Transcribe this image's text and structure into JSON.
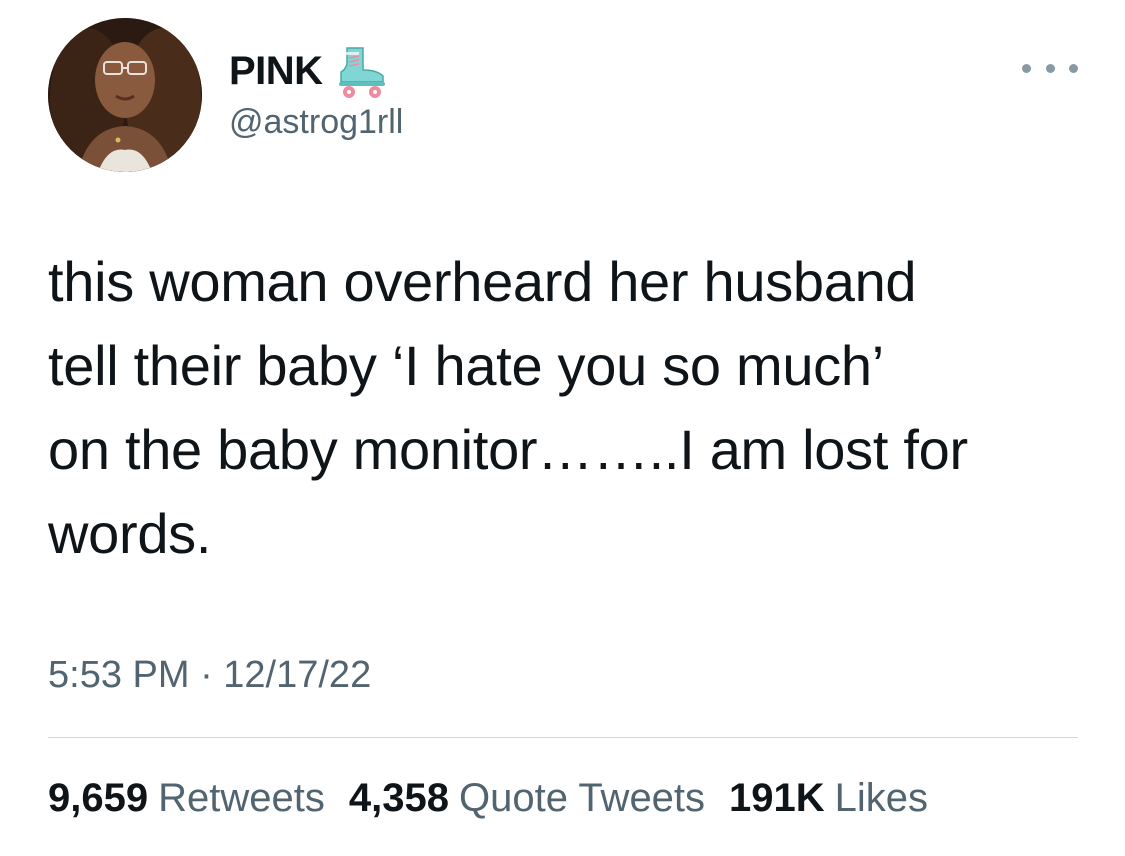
{
  "user": {
    "display_name": "PINK",
    "handle": "@astrog1rll",
    "name_emoji": "roller-skate-icon"
  },
  "tweet": {
    "text": "this woman overheard her husband\ntell their baby ‘I hate you so much’\non the baby monitor……..I am lost for\nwords.",
    "timestamp": "5:53 PM · 12/17/22"
  },
  "stats": {
    "retweets_count": "9,659",
    "retweets_label": "Retweets",
    "quotes_count": "4,358",
    "quotes_label": "Quote Tweets",
    "likes_count": "191K",
    "likes_label": "Likes"
  },
  "icons": {
    "more": "more-options-icon"
  },
  "colors": {
    "primary_text": "#0f1419",
    "secondary_text": "#536471",
    "divider": "#cfd9de",
    "skate_teal": "#7fd6d4",
    "skate_wheel": "#f08aa0"
  }
}
